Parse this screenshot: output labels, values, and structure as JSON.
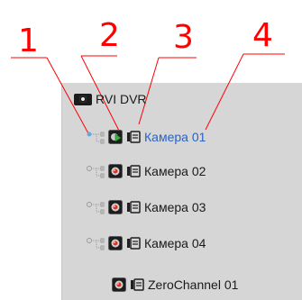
{
  "annotations": {
    "labels": [
      "1",
      "2",
      "3",
      "4"
    ],
    "color": "#ff0000"
  },
  "tree": {
    "root": {
      "label": "RVI DVR",
      "icon": "dvr-icon"
    },
    "rows": [
      {
        "label": "Камера 01",
        "selected": true,
        "has_tree_connector": true,
        "camera_icon": "camera-play-icon",
        "channel_icon": "channel-icon"
      },
      {
        "label": "Камера 02",
        "selected": false,
        "has_tree_connector": true,
        "camera_icon": "camera-icon",
        "channel_icon": "channel-icon"
      },
      {
        "label": "Камера 03",
        "selected": false,
        "has_tree_connector": true,
        "camera_icon": "camera-icon",
        "channel_icon": "channel-icon"
      },
      {
        "label": "Камера 04",
        "selected": false,
        "has_tree_connector": true,
        "camera_icon": "camera-icon",
        "channel_icon": "channel-icon"
      },
      {
        "label": "ZeroChannel 01",
        "selected": false,
        "has_tree_connector": false,
        "camera_icon": "camera-icon",
        "channel_icon": "channel-icon"
      }
    ]
  },
  "colors": {
    "panel_bg": "#d6d6d6",
    "selected_text": "#2a62c4",
    "text": "#1a1a1a"
  }
}
